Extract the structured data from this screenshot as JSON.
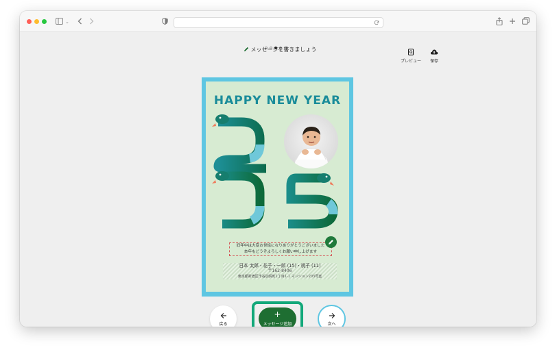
{
  "browser": {
    "icons": {
      "sidebar": "sidebar-icon",
      "back": "chevron-left-icon",
      "forward": "chevron-right-icon",
      "privacy": "shield-icon",
      "reload": "reload-icon",
      "share": "share-icon",
      "new_tab": "plus-icon",
      "tabs": "tabs-overview-icon"
    },
    "address_value": ""
  },
  "editor": {
    "steps": {
      "total": 5,
      "current": 3
    },
    "guide_text": "メッセージを書きましょう",
    "preview_label": "プレビュー",
    "save_label": "保存"
  },
  "card": {
    "headline": "HAPPY NEW YEAR",
    "year": "2025",
    "message_line1": "旧年中は大変お世話になりありがとうございました",
    "message_line2": "本年もどうぞよろしくお願い申し上げます",
    "names": "日本 太郎・花子・一郎 (15)・桃子 (11)",
    "postal": "〒162-8406",
    "address": "東京都新宿区市谷加賀町1丁目1-1 マンション203号室"
  },
  "nav": {
    "back_label": "戻る",
    "add_label": "メッセージ追加",
    "next_label": "次へ"
  },
  "colors": {
    "accent_green": "#1e6e32",
    "highlight_teal": "#12a87a",
    "frame_blue": "#5ec6e2",
    "card_bg": "#d7ebd2",
    "headline": "#1a8c9a"
  }
}
